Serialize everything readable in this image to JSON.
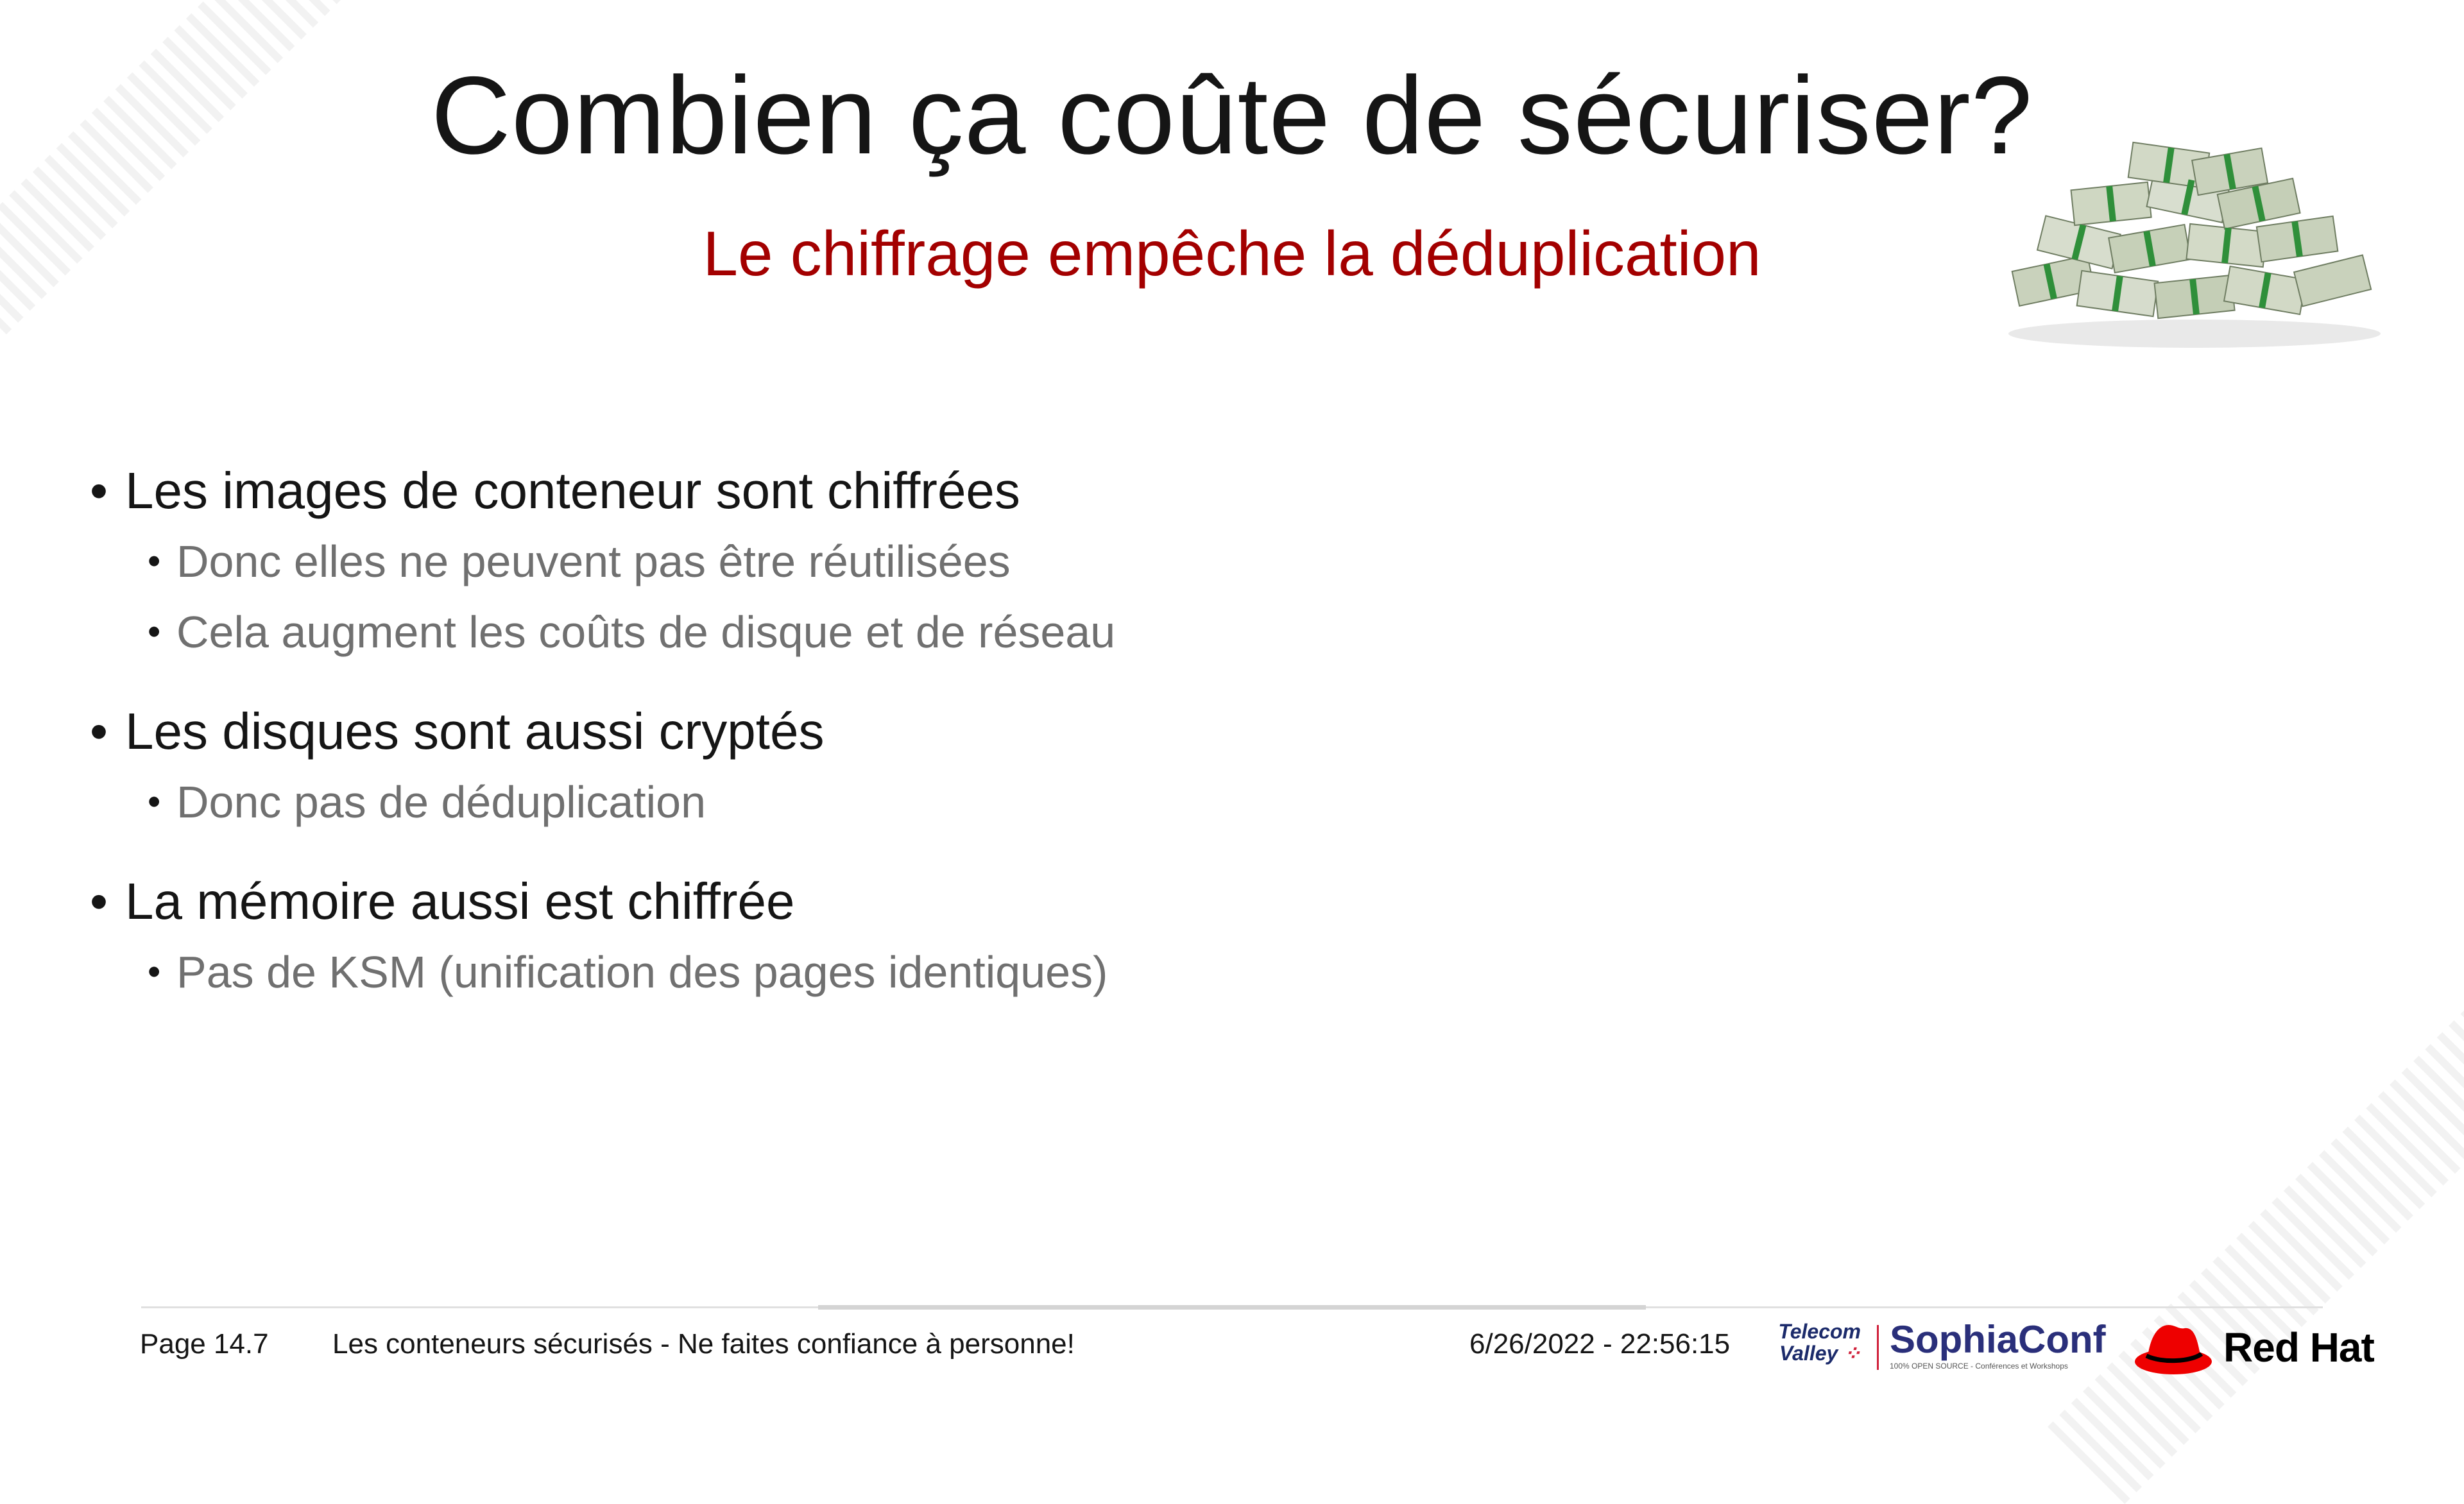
{
  "slide": {
    "title": "Combien ça coûte de sécuriser?",
    "subtitle": "Le chiffrage empêche la déduplication",
    "image": "money-pile",
    "bullets": [
      {
        "text": "Les images de conteneur sont chiffrées",
        "sub": [
          "Donc elles ne peuvent pas être réutilisées",
          "Cela augment les coûts de disque et de réseau"
        ]
      },
      {
        "text": "Les disques sont aussi cryptés",
        "sub": [
          "Donc pas de déduplication"
        ]
      },
      {
        "text": "La mémoire aussi est chiffrée",
        "sub": [
          "Pas de KSM (unification des pages identiques)"
        ]
      }
    ]
  },
  "footer": {
    "page": "Page 14.7",
    "talk_title": "Les conteneurs sécurisés - Ne faites confiance à personne!",
    "datetime": "6/26/2022 - 22:56:15",
    "logos": {
      "telecom_valley": "Telecom Valley",
      "sophiaconf_name": "SophiaConf",
      "sophiaconf_tag": "100% OPEN SOURCE - Conférences et Workshops",
      "redhat": "Red Hat"
    }
  },
  "colors": {
    "accent": "#a30000",
    "text": "#151515",
    "secondary_text": "#707070"
  }
}
